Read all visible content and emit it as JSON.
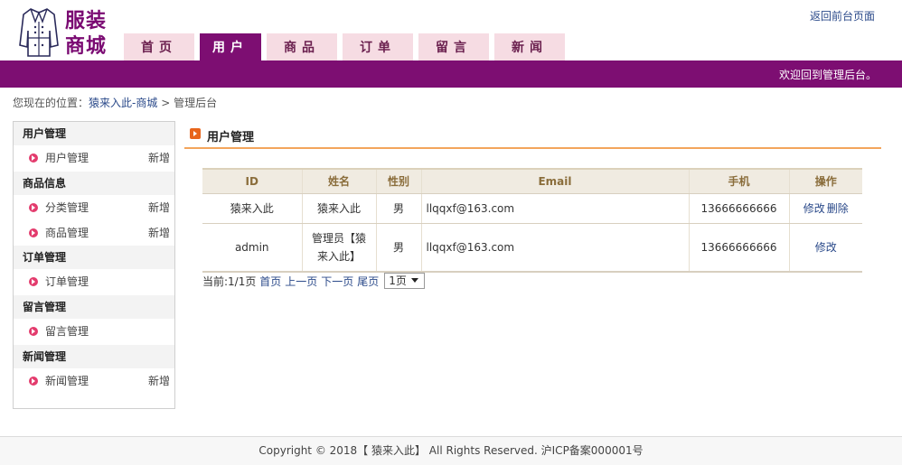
{
  "header": {
    "logo_line1": "服装",
    "logo_line2": "商城",
    "back_link": "返回前台页面",
    "welcome": "欢迎回到管理后台。"
  },
  "nav": {
    "tabs": [
      {
        "label": "首页",
        "active": false
      },
      {
        "label": "用户",
        "active": true
      },
      {
        "label": "商品",
        "active": false
      },
      {
        "label": "订单",
        "active": false
      },
      {
        "label": "留言",
        "active": false
      },
      {
        "label": "新闻",
        "active": false
      }
    ]
  },
  "breadcrumb": {
    "prefix": "您现在的位置：",
    "link": "猿来入此-商城",
    "separator": ">",
    "current": "管理后台"
  },
  "sidebar": {
    "groups": [
      {
        "title": "用户管理",
        "items": [
          {
            "label": "用户管理",
            "action": "新增"
          }
        ]
      },
      {
        "title": "商品信息",
        "items": [
          {
            "label": "分类管理",
            "action": "新增"
          },
          {
            "label": "商品管理",
            "action": "新增"
          }
        ]
      },
      {
        "title": "订单管理",
        "items": [
          {
            "label": "订单管理",
            "action": ""
          }
        ]
      },
      {
        "title": "留言管理",
        "items": [
          {
            "label": "留言管理",
            "action": ""
          }
        ]
      },
      {
        "title": "新闻管理",
        "items": [
          {
            "label": "新闻管理",
            "action": "新增"
          }
        ]
      }
    ]
  },
  "main": {
    "title": "用户管理",
    "table": {
      "headers": [
        "ID",
        "姓名",
        "性别",
        "Email",
        "手机",
        "操作"
      ],
      "rows": [
        {
          "id": "猿来入此",
          "name": "猿来入此",
          "gender": "男",
          "email": "llqqxf@163.com",
          "phone": "13666666666",
          "edit": "修改",
          "delete": "删除"
        },
        {
          "id": "admin",
          "name": "管理员【猿来入此】",
          "gender": "男",
          "email": "llqqxf@163.com",
          "phone": "13666666666",
          "edit": "修改",
          "delete": ""
        }
      ]
    },
    "pager": {
      "status": "当前:1/1页",
      "first": "首页",
      "prev": "上一页",
      "next": "下一页",
      "last": "尾页",
      "select_value": "1页"
    }
  },
  "footer": {
    "text": "Copyright © 2018【 猿来入此】 All Rights Reserved. 沪ICP备案000001号"
  },
  "colors": {
    "brand_purple": "#7d0e72",
    "tab_pink": "#f6dce3",
    "accent_orange": "#f3a55c",
    "link_blue": "#2b4a8a"
  }
}
